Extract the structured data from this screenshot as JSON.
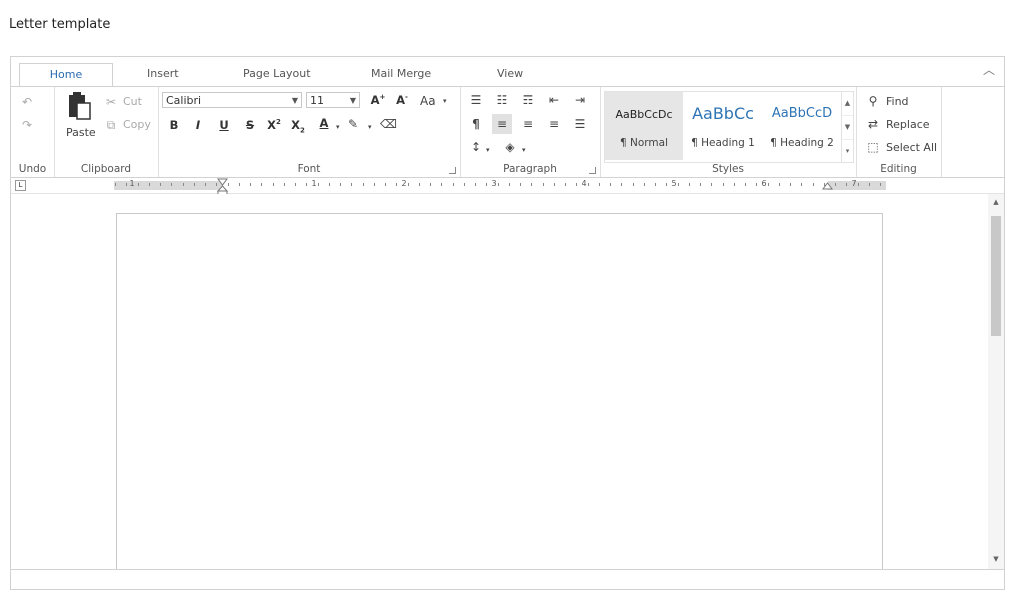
{
  "page": {
    "title": "Letter template"
  },
  "tabs": [
    "Home",
    "Insert",
    "Page Layout",
    "Mail Merge",
    "View"
  ],
  "undo_group": {
    "label": "Undo"
  },
  "clipboard": {
    "label": "Clipboard",
    "paste": "Paste",
    "cut": "Cut",
    "copy": "Copy"
  },
  "font": {
    "label": "Font",
    "family": "Calibri",
    "size": "11",
    "change_case": "Aa"
  },
  "paragraph": {
    "label": "Paragraph"
  },
  "styles": {
    "label": "Styles",
    "items": [
      {
        "preview": "AaBbCcDc",
        "name": "¶ Normal"
      },
      {
        "preview": "AaBbCc",
        "name": "¶ Heading 1"
      },
      {
        "preview": "AaBbCcD",
        "name": "¶ Heading 2"
      }
    ]
  },
  "editing": {
    "label": "Editing",
    "find": "Find",
    "replace": "Replace",
    "select_all": "Select All"
  },
  "ruler": {
    "numbers": [
      "1",
      "1",
      "2",
      "3",
      "4",
      "5",
      "6",
      "7"
    ]
  },
  "colors": {
    "accent": "#2a6bb1",
    "border": "#d2d2d2"
  }
}
